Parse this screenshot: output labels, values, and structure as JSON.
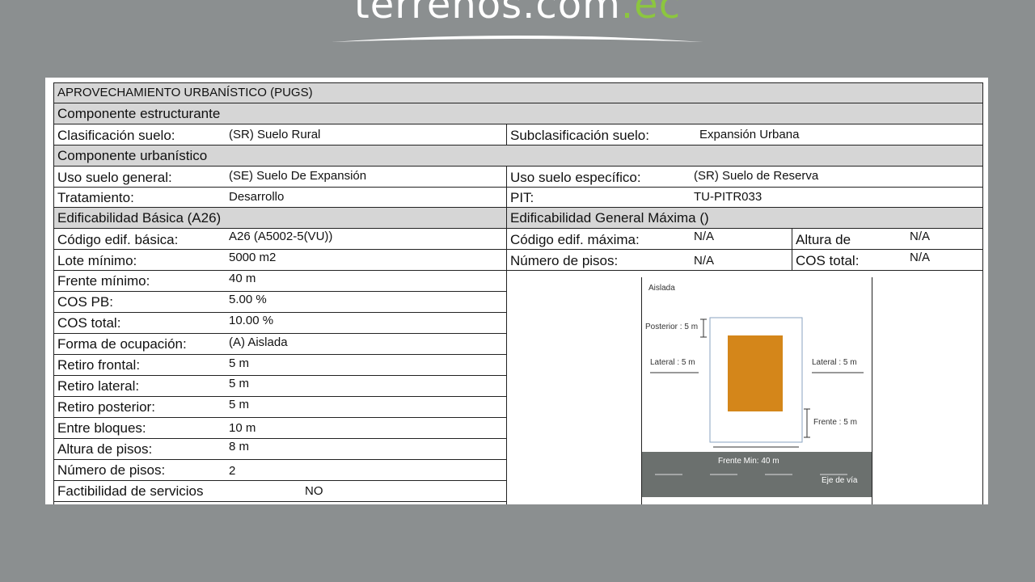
{
  "logo": {
    "main": "terrenos.com",
    "tld": ".ec"
  },
  "header": {
    "title": "APROVECHAMIENTO URBANÍSTICO (PUGS)"
  },
  "estructurante": {
    "heading": "Componente  estructurante",
    "clasificacion_label": "Clasificación suelo:",
    "clasificacion_value": "(SR) Suelo Rural",
    "subclasificacion_label": "Subclasificación suelo:",
    "subclasificacion_value": "Expansión Urbana"
  },
  "urbanistico": {
    "heading": "Componente  urbanístico",
    "uso_general_label": "Uso suelo general:",
    "uso_general_value": "(SE) Suelo De Expansión",
    "uso_especifico_label": "Uso suelo específico:",
    "uso_especifico_value": "(SR) Suelo de Reserva",
    "tratamiento_label": "Tratamiento:",
    "tratamiento_value": "Desarrollo",
    "pit_label": "PIT:",
    "pit_value": "TU-PITR033"
  },
  "basica": {
    "heading": "Edificabilidad Básica (A26)",
    "rows": [
      {
        "label": "Código edif. básica:",
        "value": "A26 (A5002-5(VU))"
      },
      {
        "label": "Lote mínimo:",
        "value": "5000 m2"
      },
      {
        "label": "Frente mínimo:",
        "value": "40 m"
      },
      {
        "label": "COS PB:",
        "value": "5.00 %"
      },
      {
        "label": "COS total:",
        "value": "10.00 %"
      },
      {
        "label": "Forma de ocupación:",
        "value": "(A) Aislada"
      },
      {
        "label": "Retiro frontal:",
        "value": "5 m"
      },
      {
        "label": "Retiro lateral:",
        "value": "5 m"
      },
      {
        "label": "Retiro posterior:",
        "value": "5 m"
      },
      {
        "label": "Entre bloques:",
        "value": "10 m"
      },
      {
        "label": "Altura de pisos:",
        "value": "8 m"
      },
      {
        "label": "Número de pisos:",
        "value": "2"
      },
      {
        "label": "Factibilidad de servicios",
        "value": "NO"
      }
    ]
  },
  "maxima": {
    "heading": "Edificabilidad General Máxima ()",
    "codigo_label": "Código edif. máxima:",
    "codigo_value": "N/A",
    "altura_label": "Altura de",
    "altura_value": "N/A",
    "pisos_label": "Número de pisos:",
    "pisos_value": "N/A",
    "cos_label": "COS total:",
    "cos_value": "N/A"
  },
  "diagram": {
    "title": "Aislada",
    "posterior": "Posterior : 5 m",
    "lateral_left": "Lateral : 5 m",
    "lateral_right": "Lateral : 5 m",
    "frente": "Frente : 5 m",
    "frente_min": "Frente Min: 40 m",
    "eje_via": "Eje de vía",
    "building_color": "#d4861a",
    "road_color": "#6b706e"
  }
}
